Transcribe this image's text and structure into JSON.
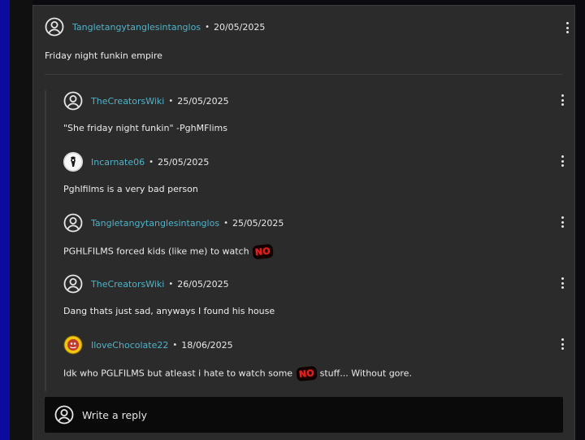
{
  "top_comment": {
    "username": "Tangletangytanglesintanglos",
    "date": "20/05/2025",
    "text": "Friday night funkin empire"
  },
  "separator": "•",
  "replies": [
    {
      "username": "TheCreatorsWiki",
      "date": "25/05/2025",
      "text_before": "\"She friday night funkin\" -PghMFlims",
      "avatar": "default-user-icon"
    },
    {
      "username": "Incarnate06",
      "date": "25/05/2025",
      "text_before": "Pghlfilms is a very bad person",
      "avatar": "custom-avatar-white"
    },
    {
      "username": "Tangletangytanglesintanglos",
      "date": "25/05/2025",
      "text_before": "PGHLFILMS forced kids (like me) to watch ",
      "sticker": "NO",
      "avatar": "default-user-icon"
    },
    {
      "username": "TheCreatorsWiki",
      "date": "26/05/2025",
      "text_before": "Dang thats just sad, anyways I found his house",
      "avatar": "default-user-icon"
    },
    {
      "username": "IloveChocolate22",
      "date": "18/06/2025",
      "text_before": "Idk who PGLFILMS but atleast i hate to watch some ",
      "sticker": "NO",
      "text_after": " stuff... Without gore.",
      "avatar": "custom-avatar-yellow"
    }
  ],
  "reply_box": {
    "placeholder": "Write a reply"
  },
  "colors": {
    "username": "#4fb3c9",
    "panel": "#2b2b2b",
    "accent_left_bar": "#0b0b9e",
    "sticker": "#e0201e"
  }
}
